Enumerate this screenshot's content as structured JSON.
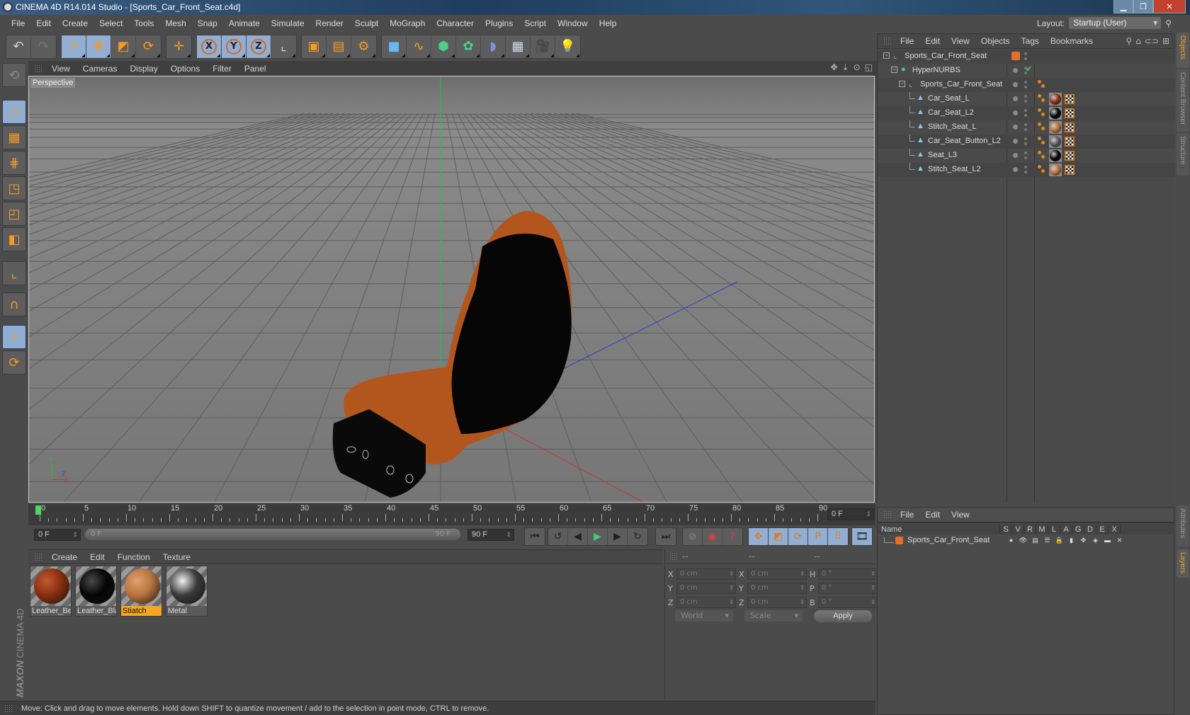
{
  "window": {
    "title": "CINEMA 4D R14.014 Studio - [Sports_Car_Front_Seat.c4d]",
    "controls": [
      "minimize",
      "restore",
      "close"
    ]
  },
  "menu": [
    "File",
    "Edit",
    "Create",
    "Select",
    "Tools",
    "Mesh",
    "Snap",
    "Animate",
    "Simulate",
    "Render",
    "Sculpt",
    "MoGraph",
    "Character",
    "Plugins",
    "Script",
    "Window",
    "Help"
  ],
  "layout": {
    "label": "Layout:",
    "value": "Startup (User)"
  },
  "toolbar": {
    "groups": [
      [
        {
          "icon": "undo-icon",
          "glyph": "↶"
        },
        {
          "icon": "redo-icon",
          "glyph": "↷",
          "disabled": true
        }
      ],
      [
        {
          "icon": "live-selection-icon",
          "glyph": "➚",
          "active": true
        },
        {
          "icon": "move-icon",
          "glyph": "✥",
          "active": true
        },
        {
          "icon": "scale-icon",
          "glyph": "◩"
        },
        {
          "icon": "rotate-icon",
          "glyph": "⟳"
        }
      ],
      [
        {
          "icon": "recent-tools-icon",
          "glyph": "✛"
        }
      ],
      [
        {
          "icon": "x-axis-lock-icon",
          "glyph": "X",
          "active": true
        },
        {
          "icon": "y-axis-lock-icon",
          "glyph": "Y",
          "active": true
        },
        {
          "icon": "z-axis-lock-icon",
          "glyph": "Z",
          "active": true
        },
        {
          "icon": "coordinate-system-icon",
          "glyph": "⌞"
        }
      ],
      [
        {
          "icon": "render-view-icon",
          "glyph": "▣"
        },
        {
          "icon": "render-picture-viewer-icon",
          "glyph": "▤"
        },
        {
          "icon": "render-settings-icon",
          "glyph": "⚙"
        }
      ],
      [
        {
          "icon": "cube-object-icon",
          "glyph": "■"
        },
        {
          "icon": "spline-pen-icon",
          "glyph": "∿"
        },
        {
          "icon": "subdivision-surface-icon",
          "glyph": "⬢"
        },
        {
          "icon": "cloner-icon",
          "glyph": "✿"
        },
        {
          "icon": "deformer-bend-icon",
          "glyph": "◗"
        },
        {
          "icon": "floor-scene-icon",
          "glyph": "▦"
        },
        {
          "icon": "camera-icon",
          "glyph": "🎥"
        },
        {
          "icon": "light-icon",
          "glyph": "💡"
        }
      ]
    ]
  },
  "left_palette": [
    {
      "icon": "make-editable-icon",
      "active": false
    },
    {
      "icon": "model-mode-icon",
      "active": true
    },
    {
      "icon": "texture-mode-icon",
      "active": false
    },
    {
      "icon": "workplane-mode-icon",
      "active": false
    },
    {
      "icon": "points-mode-icon",
      "active": false
    },
    {
      "icon": "edges-mode-icon",
      "active": false
    },
    {
      "icon": "polygons-mode-icon",
      "active": false
    },
    {
      "icon": "axis-mode-icon",
      "active": false
    },
    {
      "icon": "snapping-magnet-icon",
      "active": false
    },
    {
      "icon": "locked-workplane-icon",
      "active": true
    },
    {
      "icon": "planar-workplane-icon",
      "active": false
    }
  ],
  "brand": {
    "maxon": "MAXON",
    "product": "CINEMA 4D"
  },
  "viewport": {
    "menu": [
      "View",
      "Cameras",
      "Display",
      "Options",
      "Filter",
      "Panel"
    ],
    "label": "Perspective",
    "nav_icons": [
      "pan-icon",
      "dolly-icon",
      "orbit-icon",
      "toggle-view-icon"
    ],
    "axis_labels": {
      "y": "Y",
      "x": "X",
      "z": "Z"
    }
  },
  "timeline": {
    "ticks": [
      "0",
      "5",
      "10",
      "15",
      "20",
      "25",
      "30",
      "35",
      "40",
      "45",
      "50",
      "55",
      "60",
      "65",
      "70",
      "75",
      "80",
      "85",
      "90"
    ],
    "current_frame": "0 F",
    "start_field": "0 F",
    "range_start": "0 F",
    "range_end": "90 F",
    "end_field": "90 F"
  },
  "playback": {
    "buttons": [
      {
        "icon": "go-to-start-icon",
        "glyph": "⏮"
      },
      {
        "icon": "previous-key-icon",
        "glyph": "↺"
      },
      {
        "icon": "previous-frame-icon",
        "glyph": "◀"
      },
      {
        "icon": "play-icon",
        "glyph": "▶"
      },
      {
        "icon": "next-frame-icon",
        "glyph": "▶"
      },
      {
        "icon": "next-key-icon",
        "glyph": "↻"
      },
      {
        "icon": "go-to-end-icon",
        "glyph": "⏭"
      }
    ],
    "keys": [
      {
        "icon": "record-active-objects-icon",
        "glyph": "⊘"
      },
      {
        "icon": "autokeying-icon",
        "glyph": "◉"
      },
      {
        "icon": "keyframe-selection-icon",
        "glyph": "?"
      }
    ],
    "key_types": [
      {
        "icon": "position-key-icon",
        "glyph": "✥"
      },
      {
        "icon": "scale-key-icon",
        "glyph": "◩"
      },
      {
        "icon": "rotation-key-icon",
        "glyph": "⟳"
      },
      {
        "icon": "parameter-key-icon",
        "glyph": "P"
      },
      {
        "icon": "point-level-animation-icon",
        "glyph": "⠿"
      }
    ],
    "scheme": {
      "icon": "timeline-scheme-icon",
      "glyph": "🎞"
    }
  },
  "materials": {
    "menu": [
      "Create",
      "Edit",
      "Function",
      "Texture"
    ],
    "items": [
      {
        "name": "Leather_Be",
        "color": "#8a2e0e",
        "highlight": "#c25a35",
        "selected": false
      },
      {
        "name": "Leather_Bla",
        "color": "#050505",
        "highlight": "#4a4a4a",
        "selected": false
      },
      {
        "name": "Stiatch",
        "color": "#b8733f",
        "highlight": "#e0a070",
        "selected": true
      },
      {
        "name": "Metal",
        "color": "#3a3a3a",
        "highlight": "#f0f0f0",
        "selected": false
      }
    ]
  },
  "coordinates": {
    "headers": [
      "--",
      "--",
      "--"
    ],
    "rows": [
      {
        "l1": "X",
        "v1": "0 cm",
        "l2": "X",
        "v2": "0 cm",
        "l3": "H",
        "v3": "0 °"
      },
      {
        "l1": "Y",
        "v1": "0 cm",
        "l2": "Y",
        "v2": "0 cm",
        "l3": "P",
        "v3": "0 °"
      },
      {
        "l1": "Z",
        "v1": "0 cm",
        "l2": "Z",
        "v2": "0 cm",
        "l3": "B",
        "v3": "0 °"
      }
    ],
    "space": "World",
    "mode": "Scale",
    "apply": "Apply"
  },
  "status": "Move: Click and drag to move elements. Hold down SHIFT to quantize movement / add to the selection in point mode, CTRL to remove.",
  "objects": {
    "menu": [
      "File",
      "Edit",
      "View",
      "Objects",
      "Tags",
      "Bookmarks"
    ],
    "tools": [
      "search-icon",
      "home-icon",
      "link-icon",
      "new-view-icon"
    ],
    "tree": [
      {
        "name": "Sports_Car_Front_Seat",
        "type": "null",
        "depth": 0,
        "layer": true,
        "tags": []
      },
      {
        "name": "HyperNURBS",
        "type": "hypernurbs",
        "depth": 1,
        "enabled": true,
        "tags": []
      },
      {
        "name": "Sports_Car_Front_Seat",
        "type": "null",
        "depth": 2,
        "tags": [
          "phong"
        ]
      },
      {
        "name": "Car_Seat_L",
        "type": "polygon",
        "depth": 3,
        "tags": [
          "phong",
          "material",
          "uvw"
        ],
        "mat": "#8a2e0e"
      },
      {
        "name": "Car_Seat_L2",
        "type": "polygon",
        "depth": 3,
        "tags": [
          "phong",
          "material",
          "uvw"
        ],
        "mat": "#050505"
      },
      {
        "name": "Stitch_Seat_L",
        "type": "polygon",
        "depth": 3,
        "tags": [
          "phong",
          "material",
          "uvw"
        ],
        "mat": "#b8733f"
      },
      {
        "name": "Car_Seat_Button_L2",
        "type": "polygon",
        "depth": 3,
        "tags": [
          "phong",
          "material",
          "uvw"
        ],
        "mat": "#5a5a5a"
      },
      {
        "name": "Seat_L3",
        "type": "polygon",
        "depth": 3,
        "tags": [
          "phong",
          "material",
          "uvw"
        ],
        "mat": "#050505"
      },
      {
        "name": "Stitch_Seat_L2",
        "type": "polygon",
        "depth": 3,
        "tags": [
          "phong",
          "material",
          "uvw"
        ],
        "mat": "#b8733f"
      }
    ]
  },
  "side_tabs_top": [
    {
      "label": "Objects",
      "active": true
    },
    {
      "label": "Content Browser",
      "active": false
    },
    {
      "label": "Structure",
      "active": false
    }
  ],
  "side_tabs_bottom": [
    {
      "label": "Attributes",
      "active": false
    },
    {
      "label": "Layers",
      "active": true
    }
  ],
  "layers": {
    "menu": [
      "File",
      "Edit",
      "View"
    ],
    "columns": [
      "Name",
      "S",
      "V",
      "R",
      "M",
      "L",
      "A",
      "G",
      "D",
      "E",
      "X"
    ],
    "rows": [
      {
        "name": "Sports_Car_Front_Seat",
        "color": "#e0702a"
      }
    ]
  },
  "colors": {
    "accent": "#f5a623",
    "active_button": "#93aed3",
    "layer": "#e0702a"
  }
}
